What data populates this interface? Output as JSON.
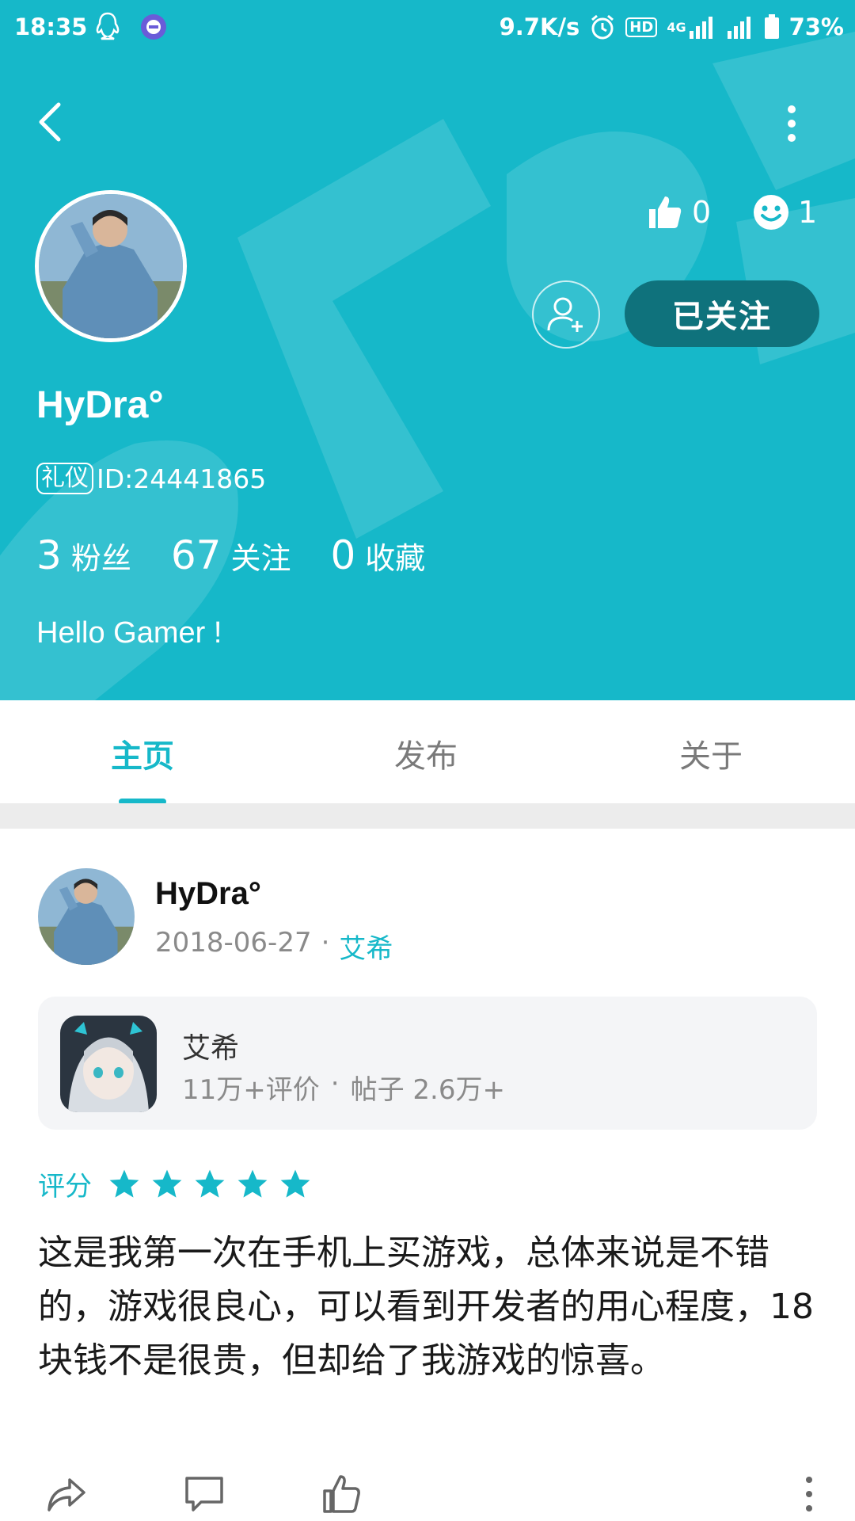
{
  "status_bar": {
    "time": "18:35",
    "net_speed": "9.7K/s",
    "hd": "HD",
    "network_type": "4G",
    "battery": "73%"
  },
  "profile": {
    "name": "HyDra°",
    "badge": "礼仪",
    "id_text": "ID:24441865",
    "likes_count": "0",
    "faces_count": "1",
    "follow_button": "已关注",
    "counts": [
      {
        "num": "3",
        "label": "粉丝"
      },
      {
        "num": "67",
        "label": "关注"
      },
      {
        "num": "0",
        "label": "收藏"
      }
    ],
    "bio": "Hello Gamer !"
  },
  "tabs": {
    "home": "主页",
    "publish": "发布",
    "about": "关于"
  },
  "post": {
    "author": "HyDra°",
    "date": "2018-06-27",
    "separator": "·",
    "game_link": "艾希",
    "game": {
      "title": "艾希",
      "reviews": "11万+评价",
      "separator": "·",
      "posts": "帖子 2.6万+"
    },
    "rating_label": "评分",
    "rating_stars": 5,
    "body": "这是我第一次在手机上买游戏，总体来说是不错的，游戏很良心，可以看到开发者的用心程度，18块钱不是很贵，但却给了我游戏的惊喜。"
  },
  "colors": {
    "accent": "#16b8c9",
    "follow_bg": "#0f727c"
  },
  "icons": [
    "back-icon",
    "more-icon",
    "thumbs-up-icon",
    "smiley-icon",
    "add-friend-icon",
    "star-icon",
    "share-icon",
    "comment-icon",
    "like-icon"
  ]
}
